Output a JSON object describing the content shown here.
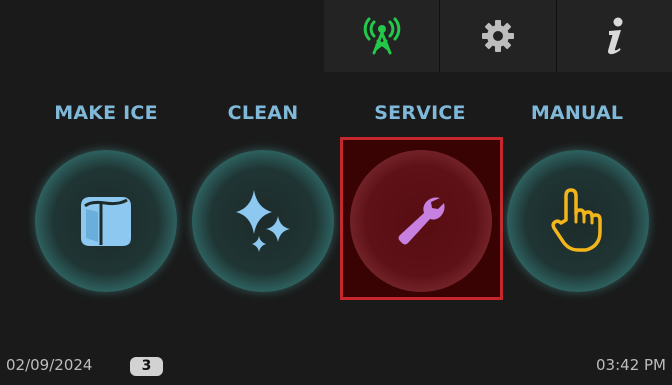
{
  "toolbar": {
    "items": [
      {
        "icon": "radio-tower-icon",
        "color": "#22c94a"
      },
      {
        "icon": "gear-icon",
        "color": "#bdbdbd"
      },
      {
        "icon": "info-icon",
        "color": "#d9d9d9"
      }
    ]
  },
  "modes": [
    {
      "label": "MAKE ICE",
      "icon": "ice-cube-icon",
      "icon_color": "#8cc8f0",
      "state": "normal"
    },
    {
      "label": "CLEAN",
      "icon": "sparkle-icon",
      "icon_color": "#8cc8f0",
      "state": "normal"
    },
    {
      "label": "SERVICE",
      "icon": "wrench-icon",
      "icon_color": "#c77fe0",
      "state": "selected"
    },
    {
      "label": "MANUAL",
      "icon": "hand-pointer-icon",
      "icon_color": "#f2b51c",
      "state": "normal"
    }
  ],
  "status": {
    "date": "02/09/2024",
    "badge": "3",
    "time": "03:42 PM"
  },
  "colors": {
    "label_blue": "#7fb8d8",
    "selected_border": "#c4282d",
    "background": "#1a1a1a"
  }
}
